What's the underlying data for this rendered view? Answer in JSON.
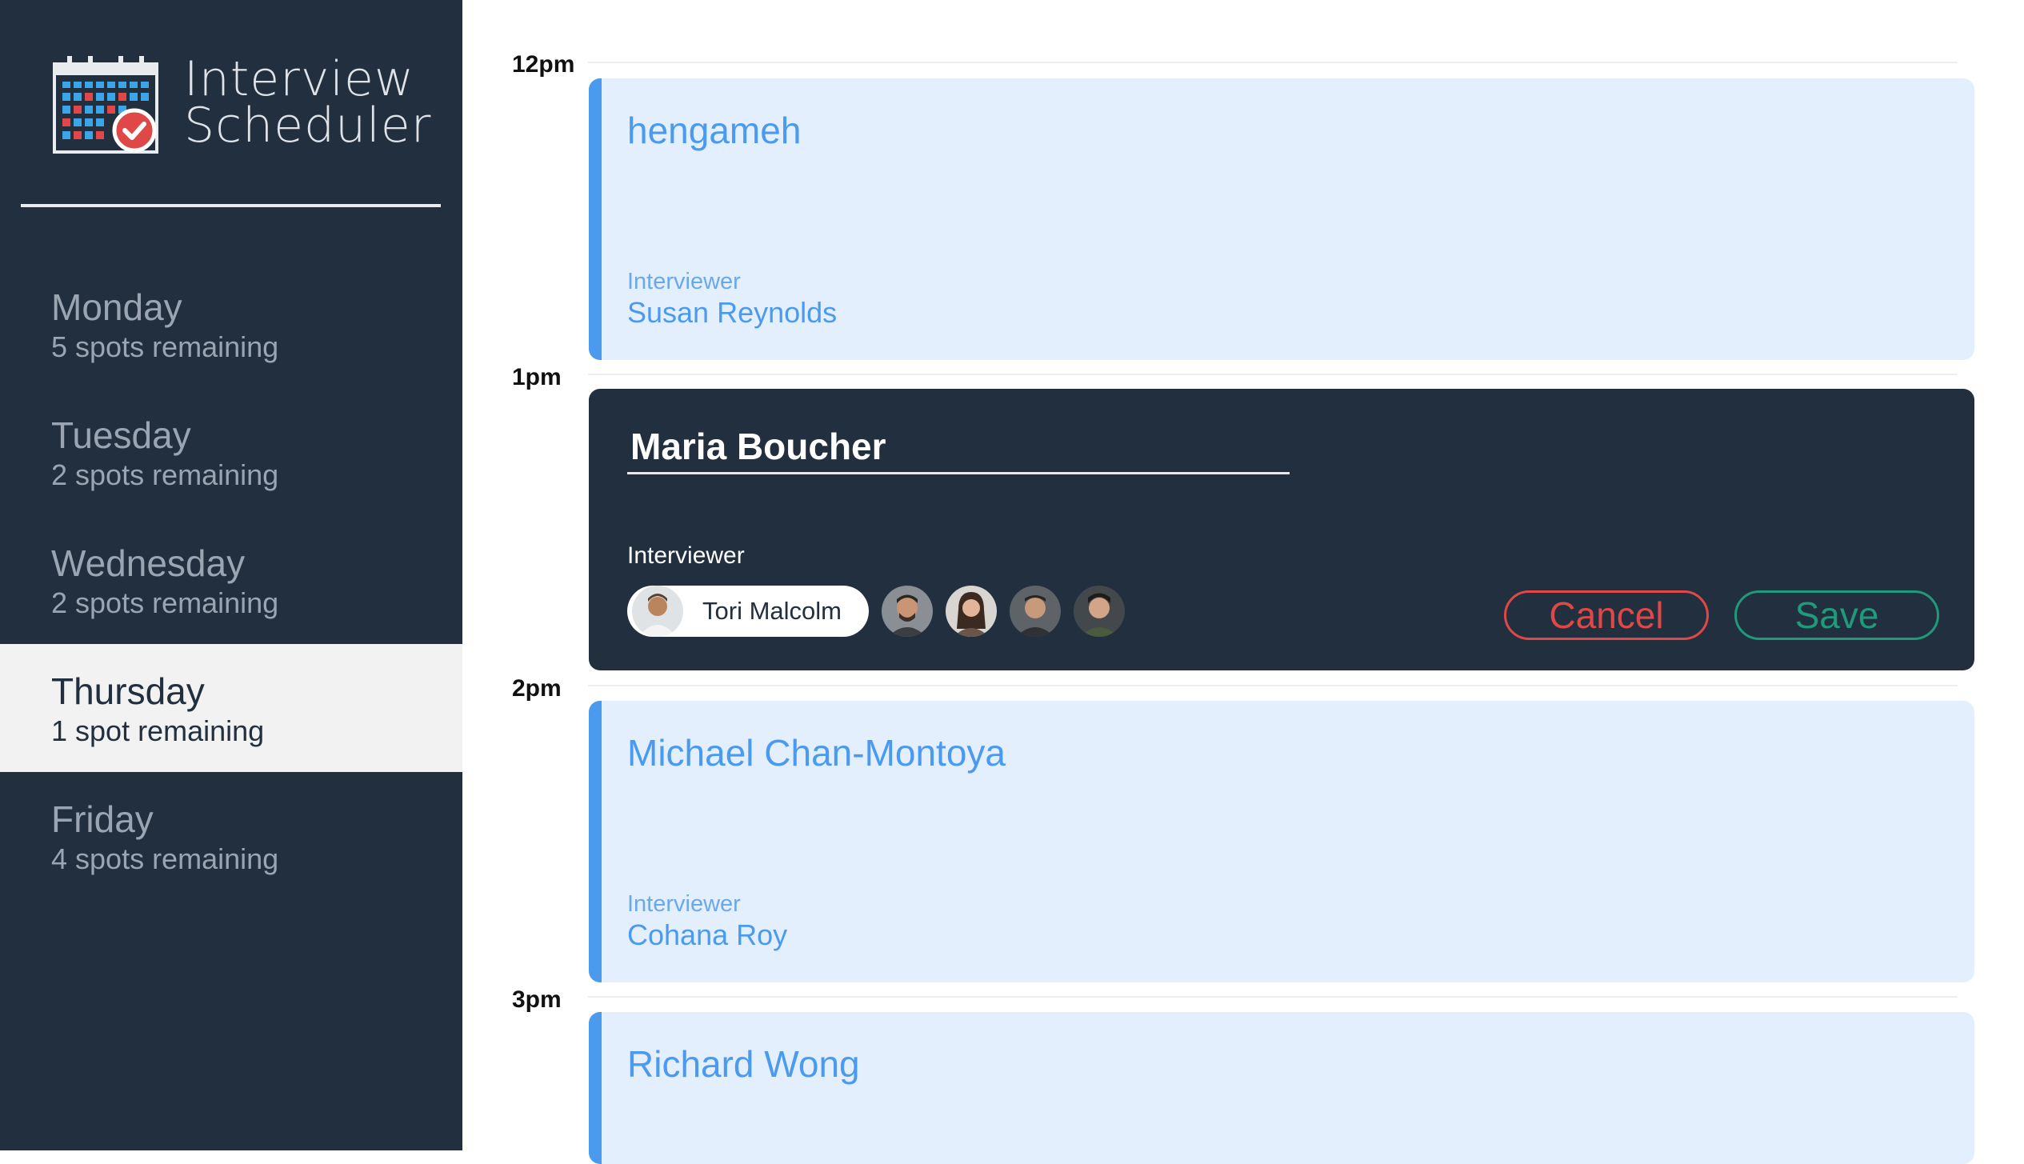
{
  "app": {
    "title_line1": "Interview",
    "title_line2": "Scheduler"
  },
  "days": [
    {
      "name": "Monday",
      "spots": "5 spots remaining",
      "selected": false
    },
    {
      "name": "Tuesday",
      "spots": "2 spots remaining",
      "selected": false
    },
    {
      "name": "Wednesday",
      "spots": "2 spots remaining",
      "selected": false
    },
    {
      "name": "Thursday",
      "spots": "1 spot remaining",
      "selected": true
    },
    {
      "name": "Friday",
      "spots": "4 spots remaining",
      "selected": false
    }
  ],
  "times": [
    "12pm",
    "1pm",
    "2pm",
    "3pm"
  ],
  "appointments": [
    {
      "student": "hengameh",
      "interviewer_label": "Interviewer",
      "interviewer": "Susan Reynolds"
    },
    {
      "student": "Michael Chan-Montoya",
      "interviewer_label": "Interviewer",
      "interviewer": "Cohana Roy"
    },
    {
      "student": "Richard Wong"
    }
  ],
  "form": {
    "student_value": "Maria Boucher",
    "interviewer_label": "Interviewer",
    "selected_interviewer": "Tori Malcolm",
    "cancel_label": "Cancel",
    "save_label": "Save"
  },
  "colors": {
    "sidebar_bg": "#222f3e",
    "accent_blue": "#4a9af0",
    "card_bg": "#e3effc",
    "cancel_red": "#e04848",
    "save_green": "#1f9a7a"
  }
}
